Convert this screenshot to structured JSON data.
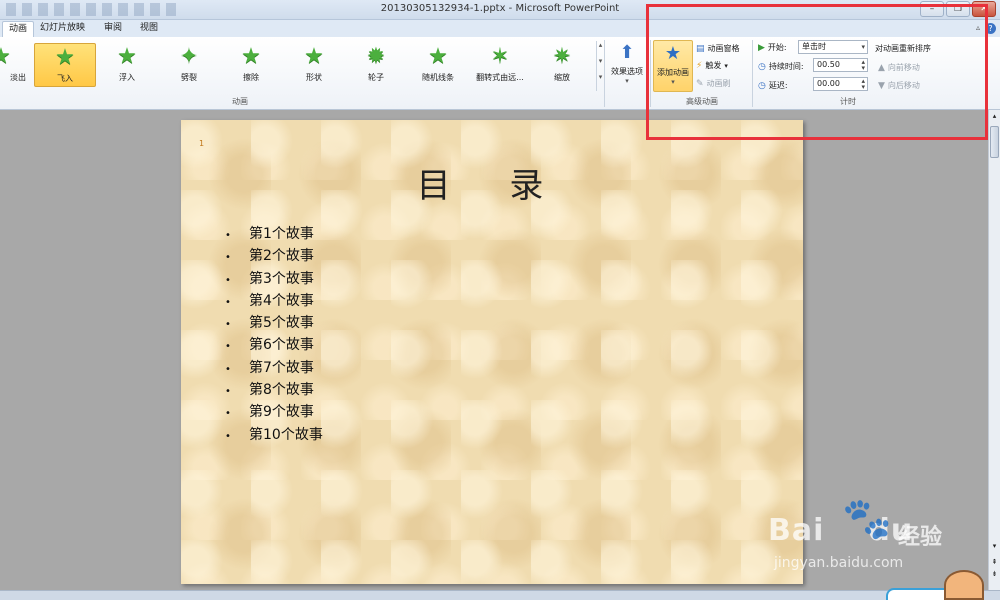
{
  "window": {
    "title": "20130305132934-1.pptx - Microsoft PowerPoint",
    "minimize": "–",
    "maximize": "❐",
    "close": "✕"
  },
  "tabs": [
    "动画",
    "幻灯片放映",
    "审阅",
    "视图"
  ],
  "active_tab": "动画",
  "animation_gallery": {
    "items": [
      {
        "label": "淡出",
        "icon": "star-icon"
      },
      {
        "label": "飞入",
        "icon": "star-icon",
        "selected": true
      },
      {
        "label": "浮入",
        "icon": "star-icon"
      },
      {
        "label": "劈裂",
        "icon": "star-icon"
      },
      {
        "label": "擦除",
        "icon": "star-icon"
      },
      {
        "label": "形状",
        "icon": "star-icon"
      },
      {
        "label": "轮子",
        "icon": "star-icon"
      },
      {
        "label": "随机线条",
        "icon": "star-icon"
      },
      {
        "label": "翻转式由远...",
        "icon": "star-icon"
      },
      {
        "label": "缩放",
        "icon": "star-icon"
      }
    ],
    "group_label": "动画"
  },
  "effect_options": {
    "label": "效果选项",
    "icon": "up-arrow-icon"
  },
  "advanced_animation": {
    "group_label": "高级动画",
    "add_animation": "添加动画",
    "animation_pane": "动画窗格",
    "trigger": "触发",
    "animation_painter": "动画刷"
  },
  "timing": {
    "group_label": "计时",
    "start_label": "开始:",
    "start_value": "单击时",
    "duration_label": "持续时间:",
    "duration_value": "00.50",
    "delay_label": "延迟:",
    "delay_value": "00.00",
    "reorder_label": "对动画重新排序",
    "move_earlier": "向前移动",
    "move_later": "向后移动"
  },
  "slide": {
    "marker": "1",
    "title": "目 录",
    "items": [
      "第1个故事",
      "第2个故事",
      "第3个故事",
      "第4个故事",
      "第5个故事",
      "第6个故事",
      "第7个故事",
      "第8个故事",
      "第9个故事",
      "第10个故事"
    ]
  },
  "watermark": {
    "logo": "Bai",
    "logo_tail": "du",
    "cn": "经验",
    "url": "jingyan.baidu.com"
  },
  "colors": {
    "highlight_box": "#e8313b",
    "selected_animation": "#ffc846",
    "star": "#4caf3e"
  }
}
